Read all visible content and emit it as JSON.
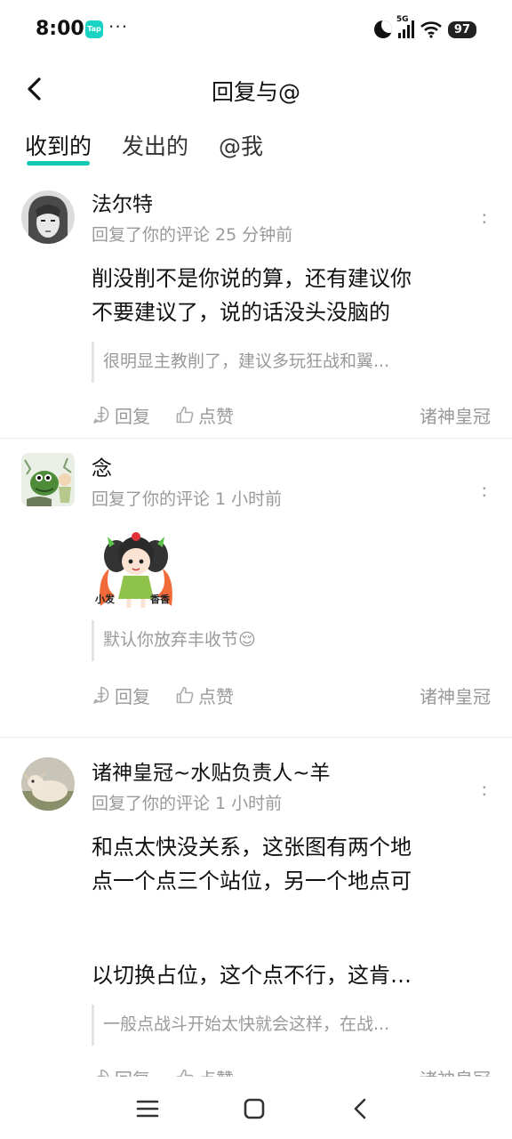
{
  "status": {
    "time": "8:00",
    "app_badge": "Tap",
    "dots": "···",
    "network": "5G",
    "battery": "97"
  },
  "header": {
    "title": "回复与@"
  },
  "tabs": [
    {
      "label": "收到的",
      "active": true
    },
    {
      "label": "发出的",
      "active": false
    },
    {
      "label": "@我",
      "active": false
    }
  ],
  "items": [
    {
      "name": "法尔特",
      "meta": "回复了你的评论 25 分钟前",
      "content_line1": "削没削不是你说的算，还有建议你",
      "content_line2": "不要建议了，说的话没头没脑的",
      "quote": "很明显主教削了，建议多玩狂战和翼...",
      "reply_label": "回复",
      "like_label": "点赞",
      "circle": "诸神皇冠"
    },
    {
      "name": "念",
      "meta": "回复了你的评论 1 小时前",
      "sticker_left": "小发",
      "sticker_right": "香香",
      "quote": "默认你放弃丰收节😌",
      "reply_label": "回复",
      "like_label": "点赞",
      "circle": "诸神皇冠"
    },
    {
      "name": "诸神皇冠~水贴负责人~羊",
      "meta": "回复了你的评论 1 小时前",
      "content_line1": "和点太快没关系，这张图有两个地",
      "content_line2": "点一个点三个站位，另一个地点可",
      "content_line3": "以切换占位，这个点不行，这肯…",
      "quote": "一般点战斗开始太快就会这样，在战...",
      "reply_label": "回复",
      "like_label": "点赞",
      "circle": "诸神皇冠"
    }
  ]
}
